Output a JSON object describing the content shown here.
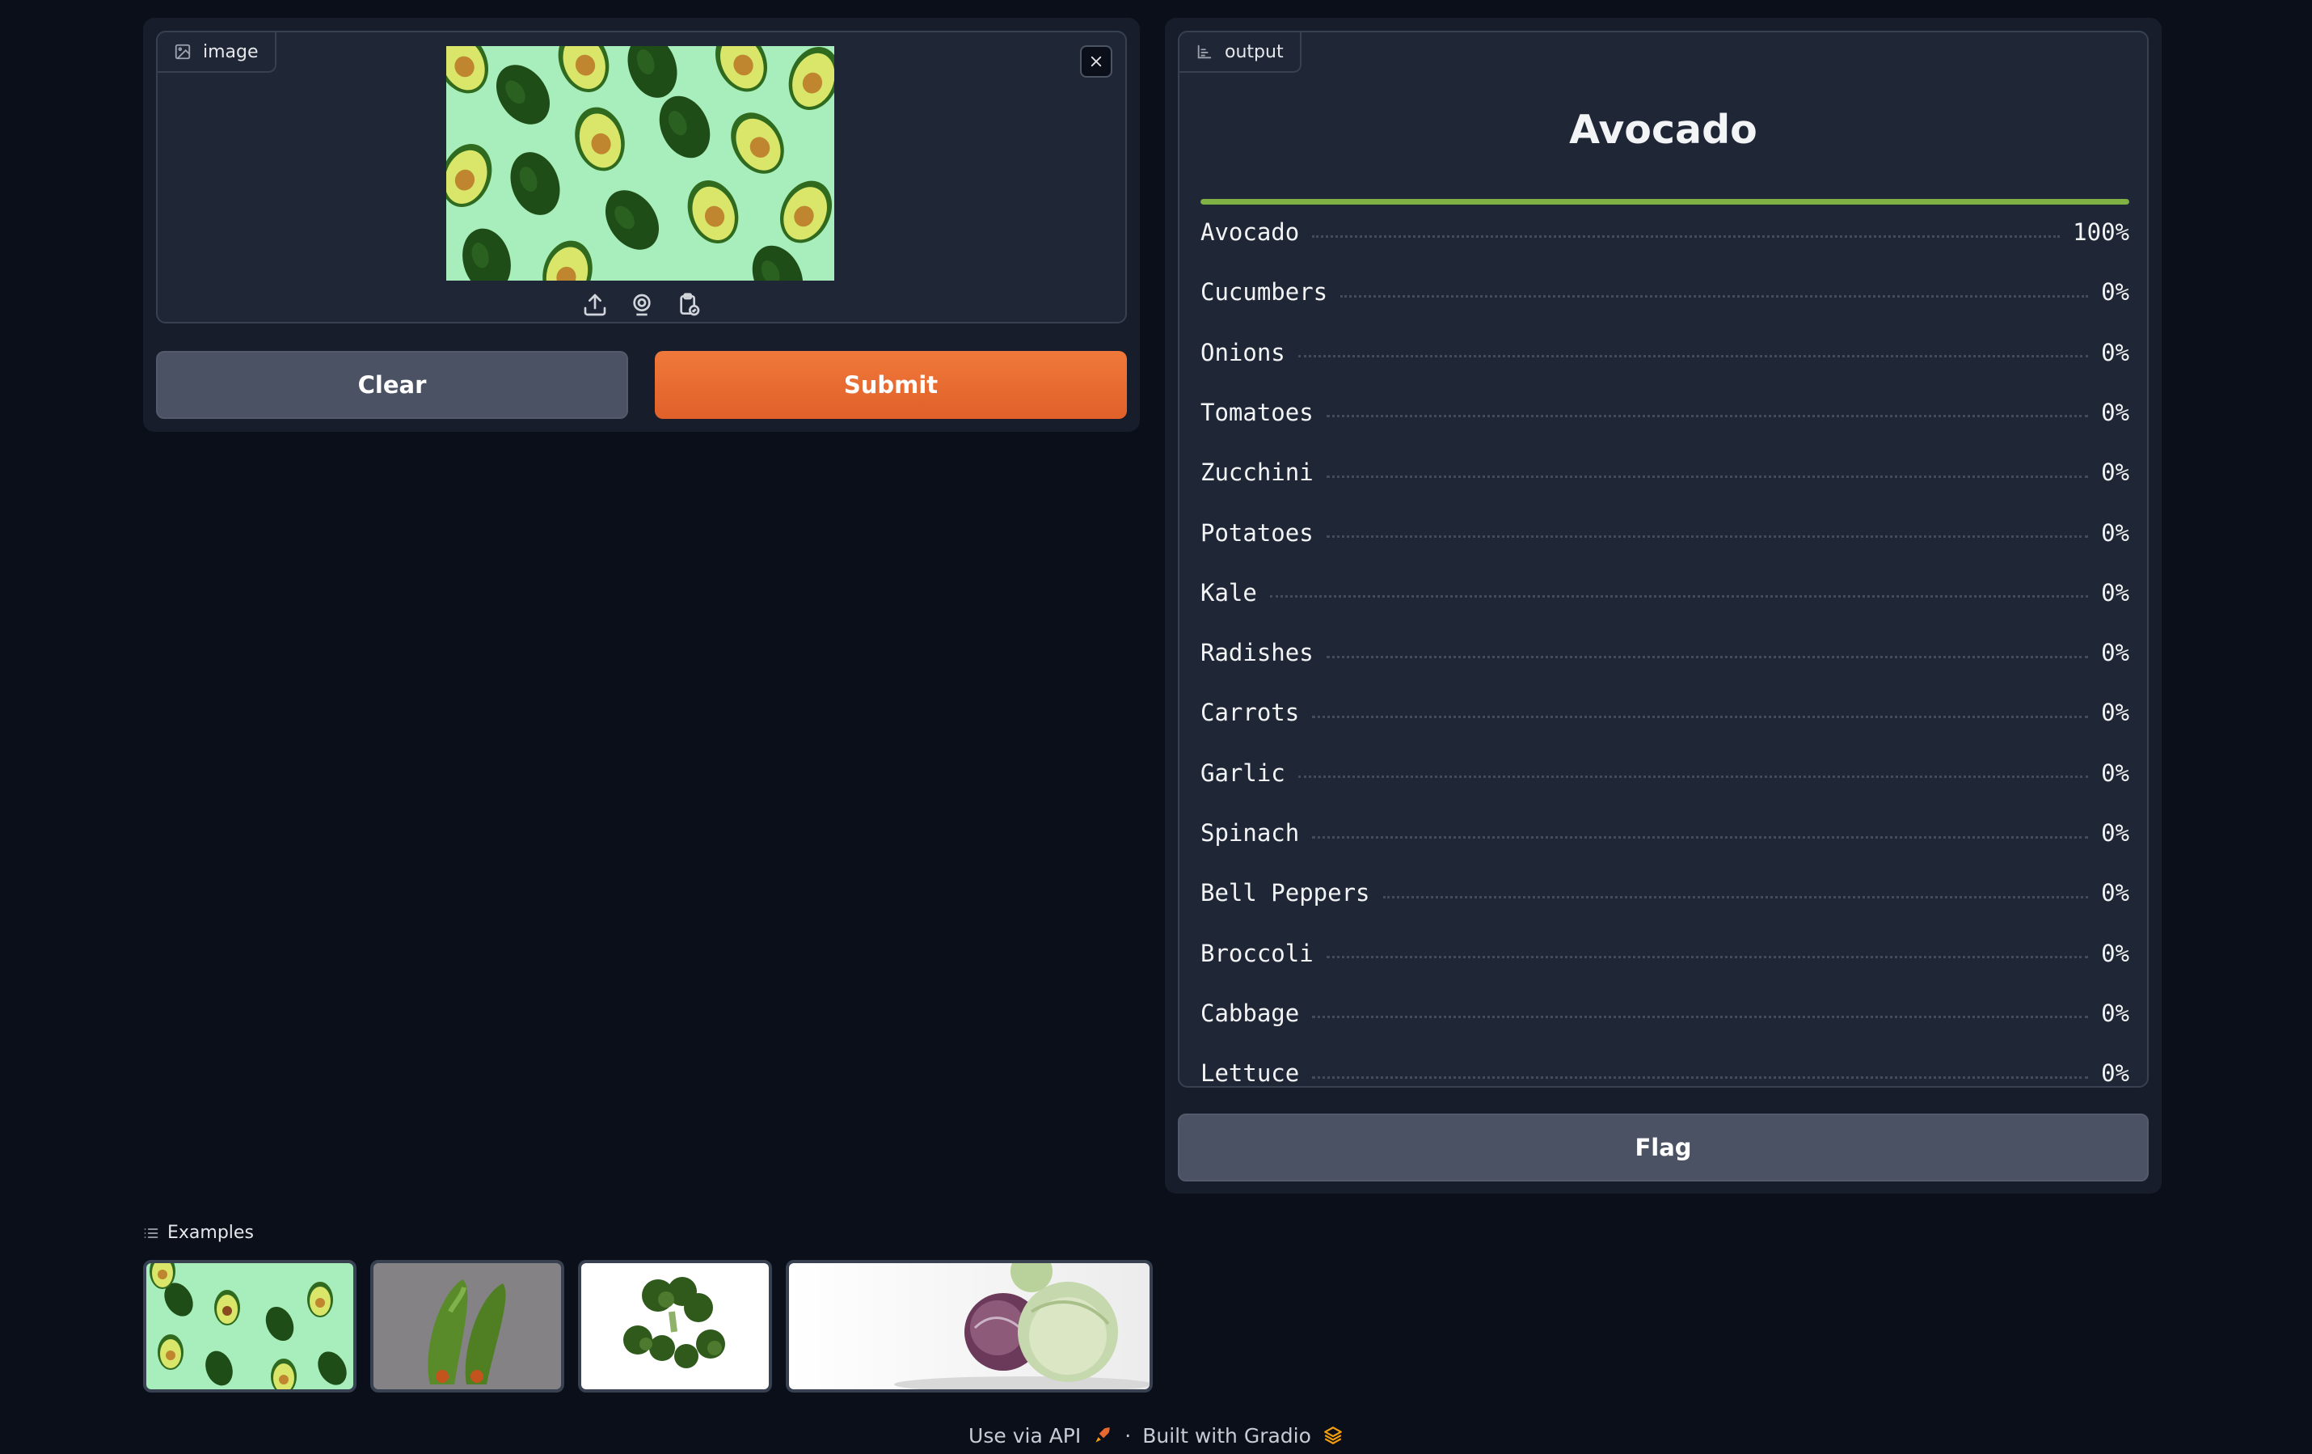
{
  "input": {
    "label": "image",
    "source_icons": [
      "upload-icon",
      "webcam-icon",
      "clipboard-icon"
    ]
  },
  "buttons": {
    "clear": "Clear",
    "submit": "Submit",
    "flag": "Flag"
  },
  "output": {
    "label": "output",
    "top_label": "Avocado",
    "top_confidence": 1.0,
    "confidences": [
      {
        "label": "Avocado",
        "value": "100%"
      },
      {
        "label": "Cucumbers",
        "value": "0%"
      },
      {
        "label": "Onions",
        "value": "0%"
      },
      {
        "label": "Tomatoes",
        "value": "0%"
      },
      {
        "label": "Zucchini",
        "value": "0%"
      },
      {
        "label": "Potatoes",
        "value": "0%"
      },
      {
        "label": "Kale",
        "value": "0%"
      },
      {
        "label": "Radishes",
        "value": "0%"
      },
      {
        "label": "Carrots",
        "value": "0%"
      },
      {
        "label": "Garlic",
        "value": "0%"
      },
      {
        "label": "Spinach",
        "value": "0%"
      },
      {
        "label": "Bell Peppers",
        "value": "0%"
      },
      {
        "label": "Broccoli",
        "value": "0%"
      },
      {
        "label": "Cabbage",
        "value": "0%"
      },
      {
        "label": "Lettuce",
        "value": "0%"
      }
    ]
  },
  "examples": {
    "label": "Examples"
  },
  "footer": {
    "api": "Use via API",
    "separator": "·",
    "built": "Built with Gradio"
  },
  "colors": {
    "accent": "#e8692f",
    "bar": "#7fb144",
    "background": "#0b0f19"
  }
}
